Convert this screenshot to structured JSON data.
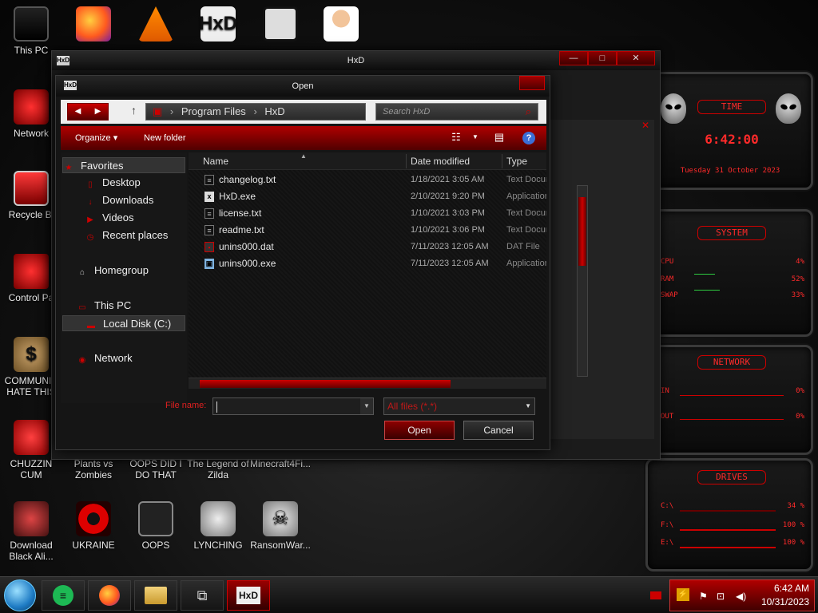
{
  "desktop": {
    "icons": [
      {
        "label": "This PC",
        "icon": "monitor-icon"
      },
      {
        "label": "",
        "icon": "firefox-icon"
      },
      {
        "label": "",
        "icon": "vlc-icon"
      },
      {
        "label": "",
        "icon": "hxd-icon"
      },
      {
        "label": "",
        "icon": "maze-icon"
      },
      {
        "label": "",
        "icon": "doctor-icon"
      },
      {
        "label": "Network",
        "icon": "network-icon"
      },
      {
        "label": "Recycle Bi",
        "icon": "recycle-bin-icon"
      },
      {
        "label": "Control Pa",
        "icon": "control-panel-icon"
      },
      {
        "label": "COMMUNIS HATE THIS",
        "icon": "money-bag-icon"
      },
      {
        "label": "CHUZZIN CUM",
        "icon": "chuzzle-icon"
      },
      {
        "label": "Plants vs Zombies",
        "icon": "plants-icon"
      },
      {
        "label": "OOPS DID I DO THAT",
        "icon": "oops-icon"
      },
      {
        "label": "The Legend of Zilda",
        "icon": "zelda-icon"
      },
      {
        "label": "Minecraft4Fi...",
        "icon": "minecraft-icon"
      },
      {
        "label": "Download Black Ali...",
        "icon": "download-icon"
      },
      {
        "label": "UKRAINE",
        "icon": "radiation-icon"
      },
      {
        "label": "OOPS",
        "icon": "alien-laptop-icon"
      },
      {
        "label": "LYNCHING",
        "icon": "lynching-icon"
      },
      {
        "label": "RansomWar...",
        "icon": "skull-icon"
      }
    ]
  },
  "gadgets": {
    "time": {
      "title": "TIME",
      "clock": "6:42:00",
      "date": "Tuesday 31 October 2023"
    },
    "system": {
      "title": "SYSTEM",
      "rows": [
        {
          "label": "CPU",
          "value": "4%"
        },
        {
          "label": "RAM",
          "value": "52%"
        },
        {
          "label": "SWAP",
          "value": "33%"
        }
      ]
    },
    "network": {
      "title": "NETWORK",
      "rows": [
        {
          "label": "IN",
          "value": "0%"
        },
        {
          "label": "OUT",
          "value": "0%"
        }
      ]
    },
    "drives": {
      "title": "DRIVES",
      "rows": [
        {
          "label": "C:\\",
          "value": "34 %"
        },
        {
          "label": "F:\\",
          "value": "100 %"
        },
        {
          "label": "E:\\",
          "value": "100 %"
        }
      ]
    }
  },
  "hxd": {
    "title": "HxD"
  },
  "dialog": {
    "title": "Open",
    "address": {
      "segments": [
        "Program Files",
        "HxD"
      ]
    },
    "search_placeholder": "Search HxD",
    "toolbar": {
      "organize": "Organize ▾",
      "new_folder": "New folder"
    },
    "nav": {
      "favorites": "Favorites",
      "desktop": "Desktop",
      "downloads": "Downloads",
      "videos": "Videos",
      "recent": "Recent places",
      "homegroup": "Homegroup",
      "thispc": "This PC",
      "localdisk": "Local Disk (C:)",
      "network": "Network"
    },
    "columns": {
      "name": "Name",
      "date": "Date modified",
      "type": "Type"
    },
    "files": [
      {
        "name": "changelog.txt",
        "date": "1/18/2021 3:05 AM",
        "type": "Text Document",
        "icon": "txt"
      },
      {
        "name": "HxD.exe",
        "date": "2/10/2021 9:20 PM",
        "type": "Application",
        "icon": "exe"
      },
      {
        "name": "license.txt",
        "date": "1/10/2021 3:03 PM",
        "type": "Text Document",
        "icon": "txt"
      },
      {
        "name": "readme.txt",
        "date": "1/10/2021 3:06 PM",
        "type": "Text Document",
        "icon": "txt"
      },
      {
        "name": "unins000.dat",
        "date": "7/11/2023 12:05 AM",
        "type": "DAT File",
        "icon": "dat"
      },
      {
        "name": "unins000.exe",
        "date": "7/11/2023 12:05 AM",
        "type": "Application",
        "icon": "exe"
      }
    ],
    "file_name_label": "File name:",
    "file_name_value": "",
    "file_type": "All files (*.*)",
    "open_label": "Open",
    "cancel_label": "Cancel"
  },
  "taskbar": {
    "items": [
      "start-orb-icon",
      "notes-icon",
      "firefox-icon",
      "file-explorer-icon",
      "task-view-icon",
      "hxd-icon"
    ],
    "time": "6:42 AM",
    "date": "10/31/2023"
  },
  "colors": {
    "accent": "#c00000",
    "text_red": "#ff2a2a",
    "background": "#111111"
  }
}
